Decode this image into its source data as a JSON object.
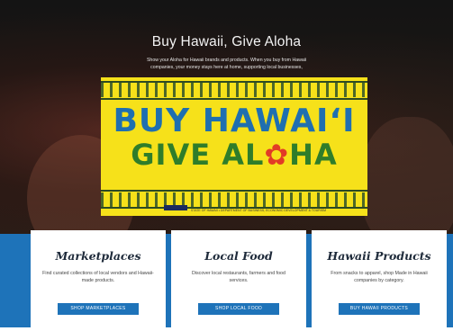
{
  "hero": {
    "title": "Buy Hawaii, Give Aloha",
    "text": "Show your Aloha for Hawaii brands and products. When you buy from Hawaii companies, your money stays here at home, supporting local businesses,"
  },
  "banner": {
    "line1": "BUY HAWAIʻI",
    "line2_a": "GIVE AL",
    "line2_flower": "✿",
    "line2_b": "HA",
    "footer": "STATE OF HAWAII • DEPARTMENT OF BUSINESS, ECONOMIC DEVELOPMENT & TOURISM"
  },
  "cards": [
    {
      "title": "Marketplaces",
      "text": "Find curated collections of local vendors and Hawaii-made products.",
      "button": "SHOP MARKETPLACES"
    },
    {
      "title": "Local Food",
      "text": "Discover local restaurants, farmers and food services.",
      "button": "SHOP LOCAL FOOD"
    },
    {
      "title": "Hawaii Products",
      "text": "From snacks to apparel, shop Made in Hawaii companies by category.",
      "button": "BUY HAWAII PRODUCTS"
    }
  ]
}
